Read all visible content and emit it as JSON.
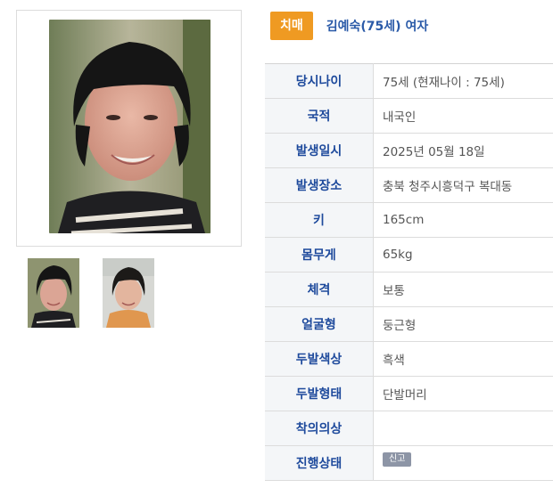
{
  "header": {
    "category_badge": "치매",
    "person_title": "김예숙(75세) 여자"
  },
  "info": [
    {
      "label": "당시나이",
      "value": "75세 (현재나이 : 75세)"
    },
    {
      "label": "국적",
      "value": "내국인"
    },
    {
      "label": "발생일시",
      "value": "2025년 05월 18일"
    },
    {
      "label": "발생장소",
      "value": "충북 청주시흥덕구 복대동"
    },
    {
      "label": "키",
      "value": "165cm"
    },
    {
      "label": "몸무게",
      "value": "65kg"
    },
    {
      "label": "체격",
      "value": "보통"
    },
    {
      "label": "얼굴형",
      "value": "둥근형"
    },
    {
      "label": "두발색상",
      "value": "흑색"
    },
    {
      "label": "두발형태",
      "value": "단발머리"
    },
    {
      "label": "착의의상",
      "value": ""
    },
    {
      "label": "진행상태",
      "value": ""
    }
  ],
  "status": {
    "tag": "신고",
    "color": "#8d95a6"
  },
  "colors": {
    "badge": "#ef9a22",
    "title": "#2a5aa8",
    "label_text": "#1e4a9c",
    "label_bg": "#f4f6f8"
  }
}
